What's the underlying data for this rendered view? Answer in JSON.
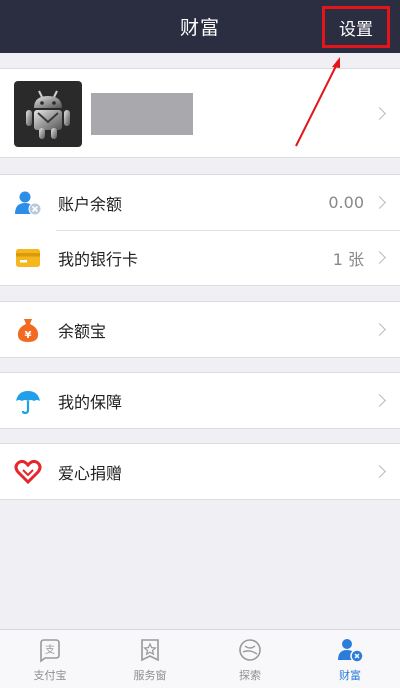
{
  "header": {
    "title": "财富",
    "settings_label": "设置"
  },
  "profile": {
    "avatar_icon": "android-robot-icon",
    "chevron_icon": "chevron-right-icon"
  },
  "account_group": {
    "rows": [
      {
        "label": "账户余额",
        "value": "0.00",
        "icon": "user-balance-icon",
        "icon_color": "#2c8ee8"
      },
      {
        "label": "我的银行卡",
        "value": "1 张",
        "icon": "bank-card-icon",
        "icon_color": "#f5b71f"
      }
    ]
  },
  "yeb_group": {
    "label": "余额宝",
    "icon": "money-bag-icon",
    "icon_color": "#f26a21"
  },
  "guard_group": {
    "label": "我的保障",
    "icon": "umbrella-icon",
    "icon_color": "#1fa0e8"
  },
  "love_group": {
    "label": "爱心捐赠",
    "icon": "heart-icon",
    "icon_color": "#e6262b"
  },
  "tabbar": {
    "tabs": [
      {
        "label": "支付宝",
        "icon": "alipay-icon",
        "active": false
      },
      {
        "label": "服务窗",
        "icon": "star-window-icon",
        "active": false
      },
      {
        "label": "探索",
        "icon": "compass-icon",
        "active": false
      },
      {
        "label": "财富",
        "icon": "wealth-user-icon",
        "active": true
      }
    ]
  },
  "colors": {
    "header_bg": "#2b2d40",
    "highlight_red": "#e4151a",
    "accent_blue": "#2c7cd9",
    "page_bg": "#efeff4"
  }
}
